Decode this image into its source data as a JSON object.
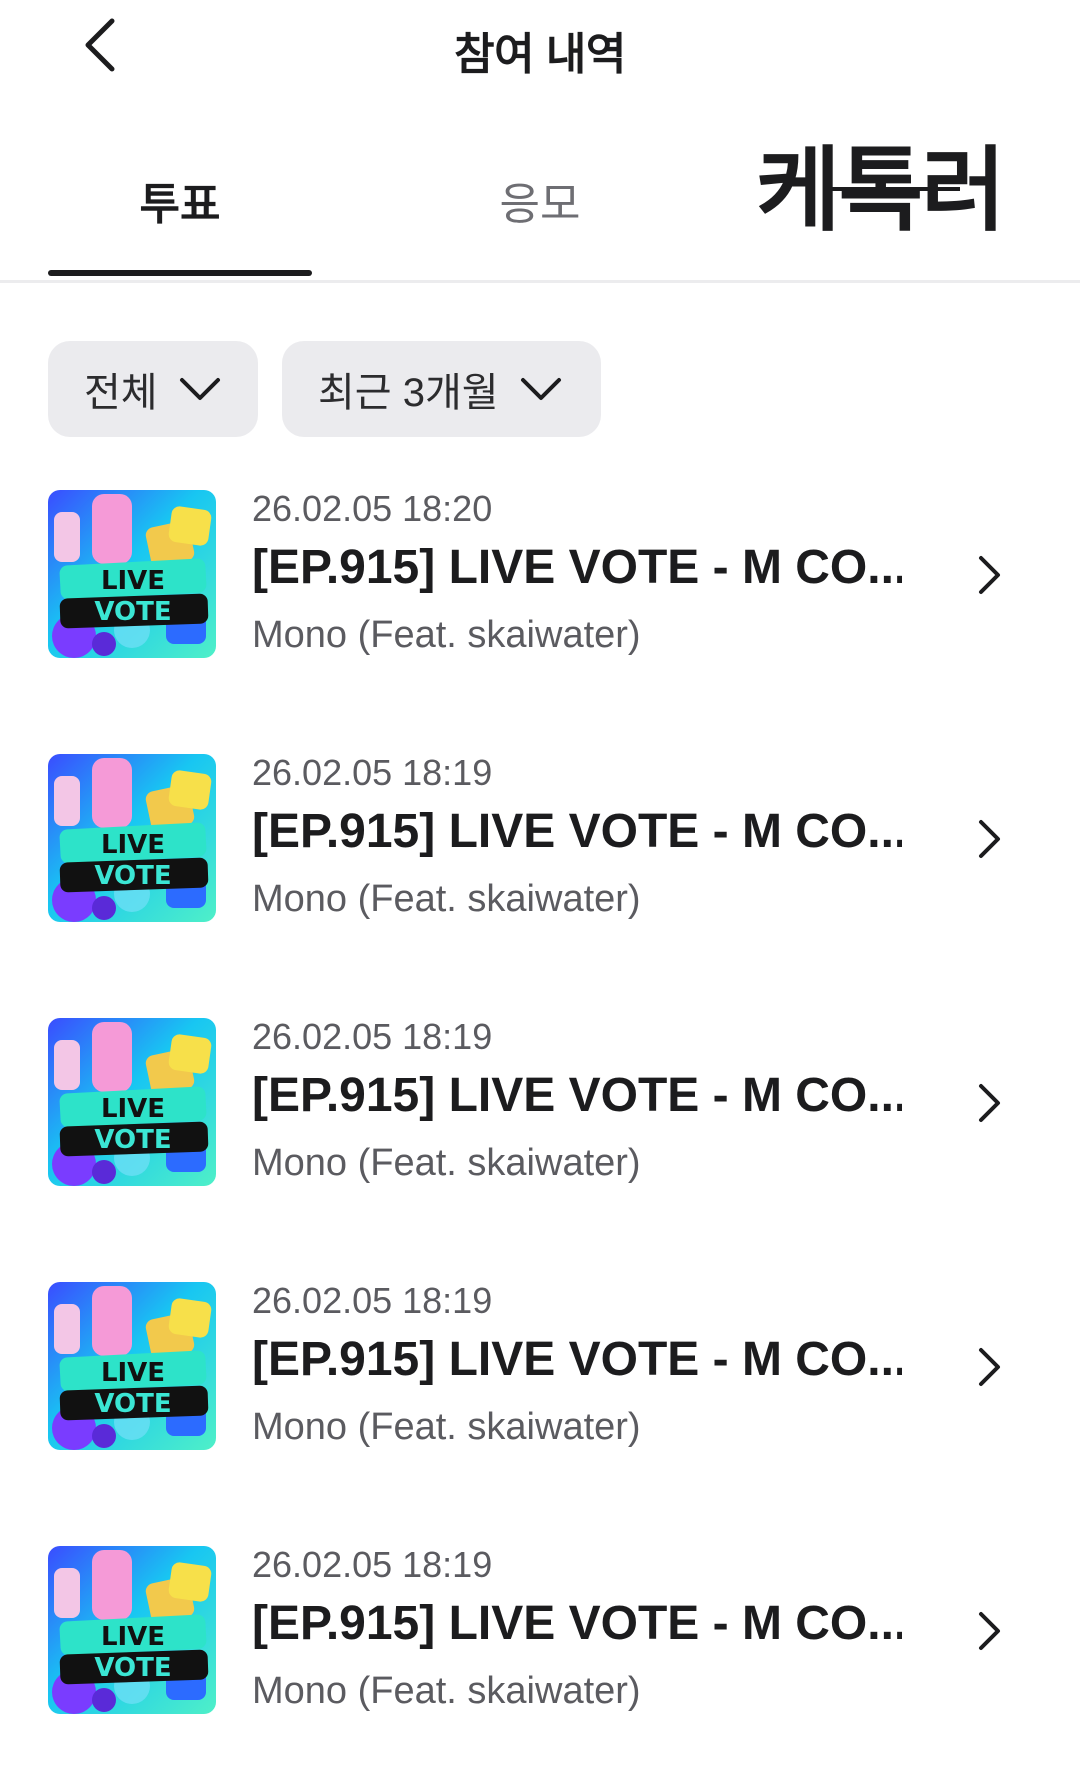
{
  "header": {
    "back_icon": "chevron-left-icon",
    "title": "참여 내역"
  },
  "tabs": [
    {
      "label": "투표",
      "active": true
    },
    {
      "label": "응모",
      "active": false
    },
    {
      "label": "케톡러",
      "active": false
    }
  ],
  "filters": [
    {
      "label": "전체",
      "icon": "chevron-down-icon"
    },
    {
      "label": "최근 3개월",
      "icon": "chevron-down-icon"
    }
  ],
  "list": {
    "items": [
      {
        "date": "26.02.05 18:20",
        "title": "[EP.915] LIVE VOTE - M CO...",
        "subtitle": "Mono (Feat. skaiwater)",
        "thumb_text_1": "LIVE",
        "thumb_text_2": "VOTE"
      },
      {
        "date": "26.02.05 18:19",
        "title": "[EP.915] LIVE VOTE - M CO...",
        "subtitle": "Mono (Feat. skaiwater)",
        "thumb_text_1": "LIVE",
        "thumb_text_2": "VOTE"
      },
      {
        "date": "26.02.05 18:19",
        "title": "[EP.915] LIVE VOTE - M CO...",
        "subtitle": "Mono (Feat. skaiwater)",
        "thumb_text_1": "LIVE",
        "thumb_text_2": "VOTE"
      },
      {
        "date": "26.02.05 18:19",
        "title": "[EP.915] LIVE VOTE - M CO...",
        "subtitle": "Mono (Feat. skaiwater)",
        "thumb_text_1": "LIVE",
        "thumb_text_2": "VOTE"
      },
      {
        "date": "26.02.05 18:19",
        "title": "[EP.915] LIVE VOTE - M CO...",
        "subtitle": "Mono (Feat. skaiwater)",
        "thumb_text_1": "LIVE",
        "thumb_text_2": "VOTE"
      }
    ]
  },
  "colors": {
    "text_primary": "#1c1c1e",
    "text_secondary": "#5b5b60",
    "chip_bg": "#ebebee",
    "divider": "#ececee"
  }
}
